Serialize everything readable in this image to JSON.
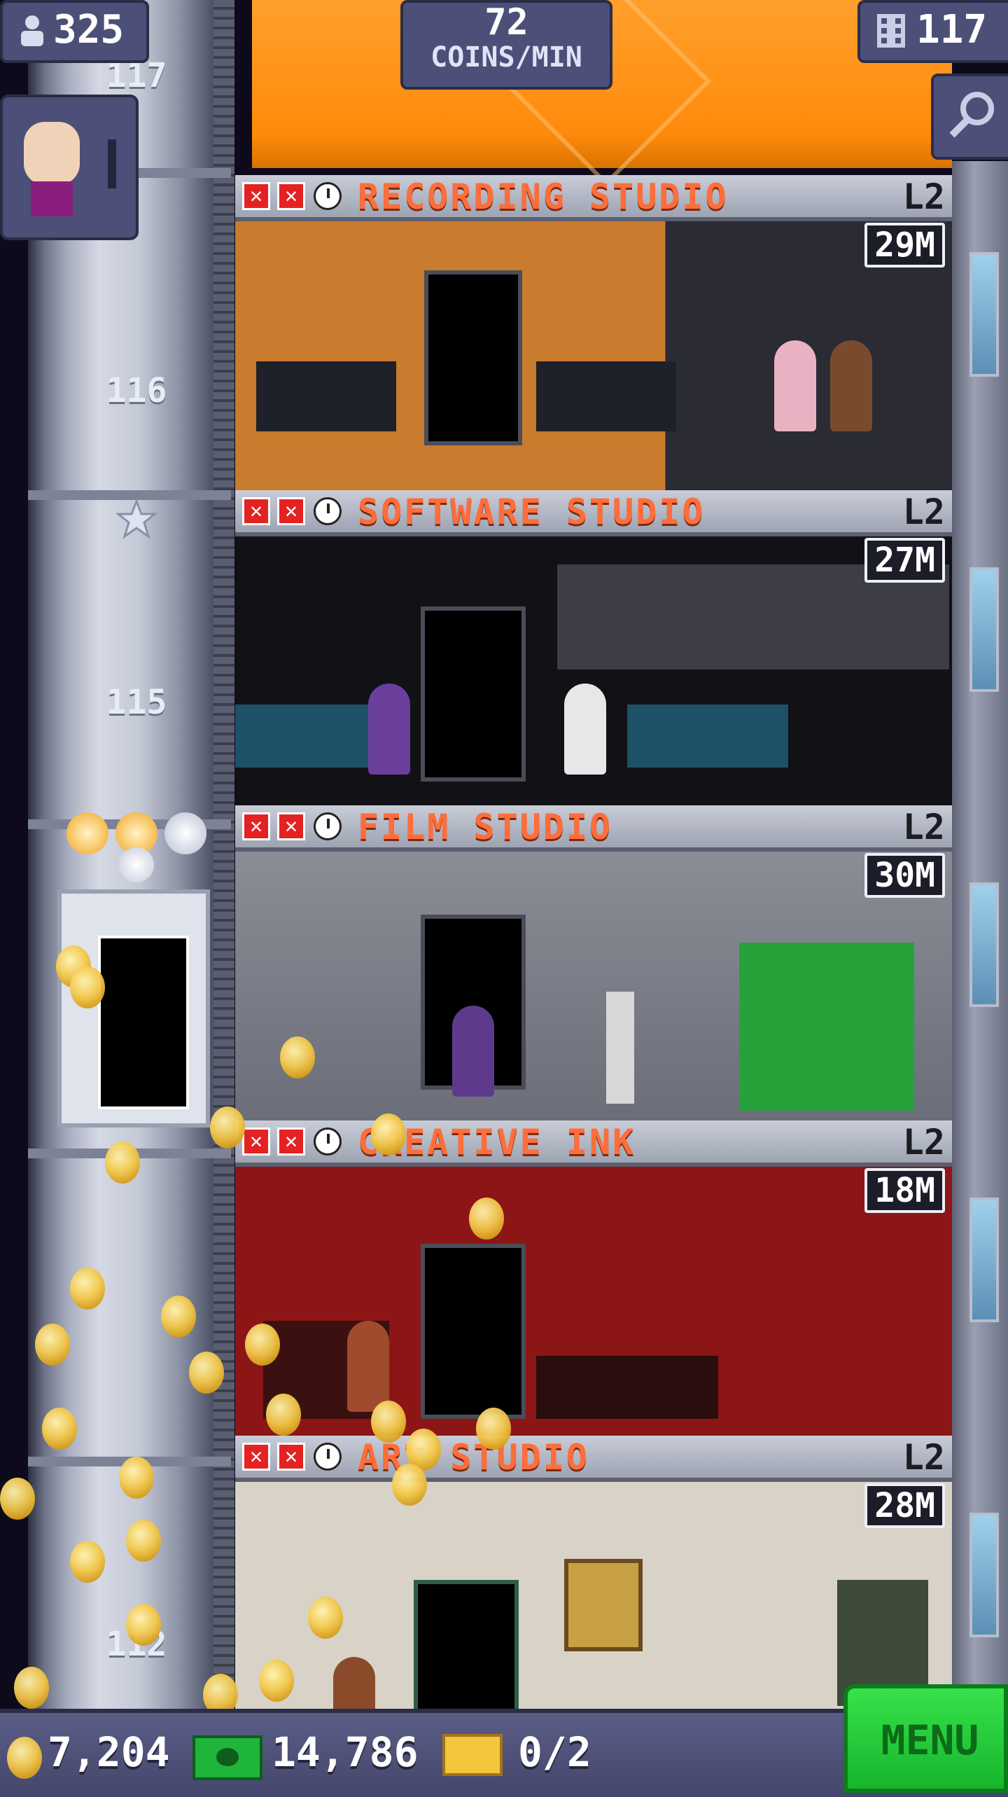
{
  "hud": {
    "population": "325",
    "coins_per_min_value": "72",
    "coins_per_min_label": "COINS/MIN",
    "floor_count": "117"
  },
  "shaft": {
    "floor_labels": [
      "117",
      "116",
      "115",
      "112"
    ]
  },
  "rooms": [
    {
      "name": "RECORDING STUDIO",
      "level": "L2",
      "time": "29M",
      "accent": "#c97b2e"
    },
    {
      "name": "SOFTWARE STUDIO",
      "level": "L2",
      "time": "27M",
      "accent": "#1b1c22"
    },
    {
      "name": "FILM STUDIO",
      "level": "L2",
      "time": "30M",
      "accent": "#7c7f88"
    },
    {
      "name": "CREATIVE INK",
      "level": "L2",
      "time": "18M",
      "accent": "#8c1616"
    },
    {
      "name": "ART STUDIO",
      "level": "L2",
      "time": "28M",
      "accent": "#d8d3c6"
    }
  ],
  "bottom_bar": {
    "coins": "7,204",
    "bux": "14,786",
    "tickets": "0/2",
    "menu_label": "MENU"
  },
  "colors": {
    "room_name": "#ff6d3a",
    "hud_panel": "#4c4f77",
    "menu_button": "#25c93a"
  }
}
